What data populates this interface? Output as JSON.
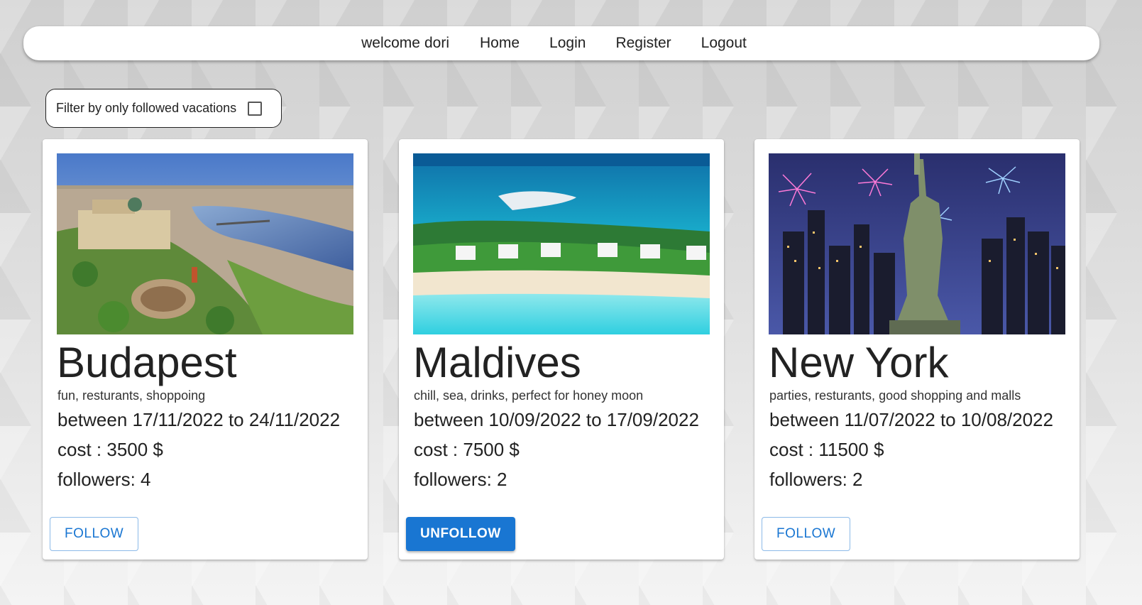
{
  "nav": {
    "welcome_word": "welcome",
    "username": "dori",
    "links": [
      "Home",
      "Login",
      "Register",
      "Logout"
    ]
  },
  "filter": {
    "label": "Filter by only followed vacations",
    "checked": false
  },
  "vacations": [
    {
      "title": "Budapest",
      "description": "fun, resturants, shoppoing",
      "dates": "between 17/11/2022 to 24/11/2022",
      "cost": "cost : 3500 $",
      "followers": "followers: 4",
      "button": "FOLLOW",
      "followed": false
    },
    {
      "title": "Maldives",
      "description": "chill, sea, drinks, perfect for honey moon",
      "dates": "between 10/09/2022 to 17/09/2022",
      "cost": "cost : 7500 $",
      "followers": "followers: 2",
      "button": "UNFOLLOW",
      "followed": true
    },
    {
      "title": "New York",
      "description": "parties, resturants, good shopping and malls",
      "dates": "between 11/07/2022 to 10/08/2022",
      "cost": "cost : 11500 $",
      "followers": "followers: 2",
      "button": "FOLLOW",
      "followed": false
    }
  ],
  "colors": {
    "primary": "#1976d2",
    "card_bg": "#ffffff",
    "nav_bg": "#ffffff"
  }
}
